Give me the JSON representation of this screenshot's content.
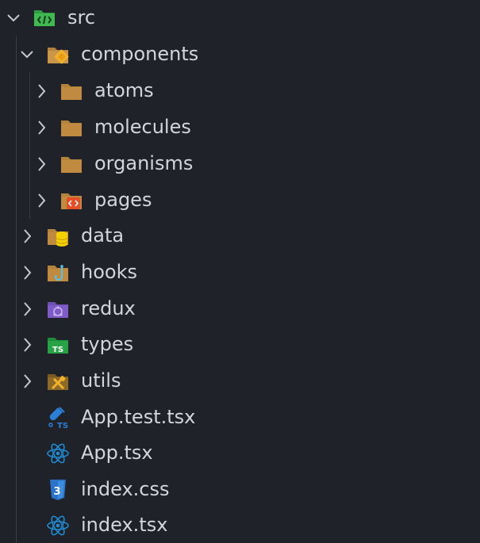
{
  "explorer": {
    "root": {
      "label": "src",
      "expanded": true,
      "icon": "folder-src-icon"
    },
    "components": {
      "label": "components",
      "expanded": true,
      "icon": "folder-components-icon"
    },
    "component_children": [
      {
        "label": "atoms",
        "icon": "folder-icon"
      },
      {
        "label": "molecules",
        "icon": "folder-icon"
      },
      {
        "label": "organisms",
        "icon": "folder-icon"
      },
      {
        "label": "pages",
        "icon": "folder-pages-icon"
      }
    ],
    "folders": [
      {
        "label": "data",
        "icon": "folder-data-icon"
      },
      {
        "label": "hooks",
        "icon": "folder-hooks-icon"
      },
      {
        "label": "redux",
        "icon": "folder-redux-icon"
      },
      {
        "label": "types",
        "icon": "folder-types-icon"
      },
      {
        "label": "utils",
        "icon": "folder-utils-icon"
      }
    ],
    "files": [
      {
        "label": "App.test.tsx",
        "icon": "test-tsx-icon"
      },
      {
        "label": "App.tsx",
        "icon": "react-icon"
      },
      {
        "label": "index.css",
        "icon": "css-icon"
      },
      {
        "label": "index.tsx",
        "icon": "react-icon"
      }
    ]
  },
  "colors": {
    "background": "#1f2228",
    "text": "#d2d6dc",
    "chevron": "#c5c8cc",
    "folder_plain": "#b3833e",
    "folder_src": "#2ea043",
    "react_blue": "#1f8ad2",
    "css_blue": "#2b72c9"
  }
}
